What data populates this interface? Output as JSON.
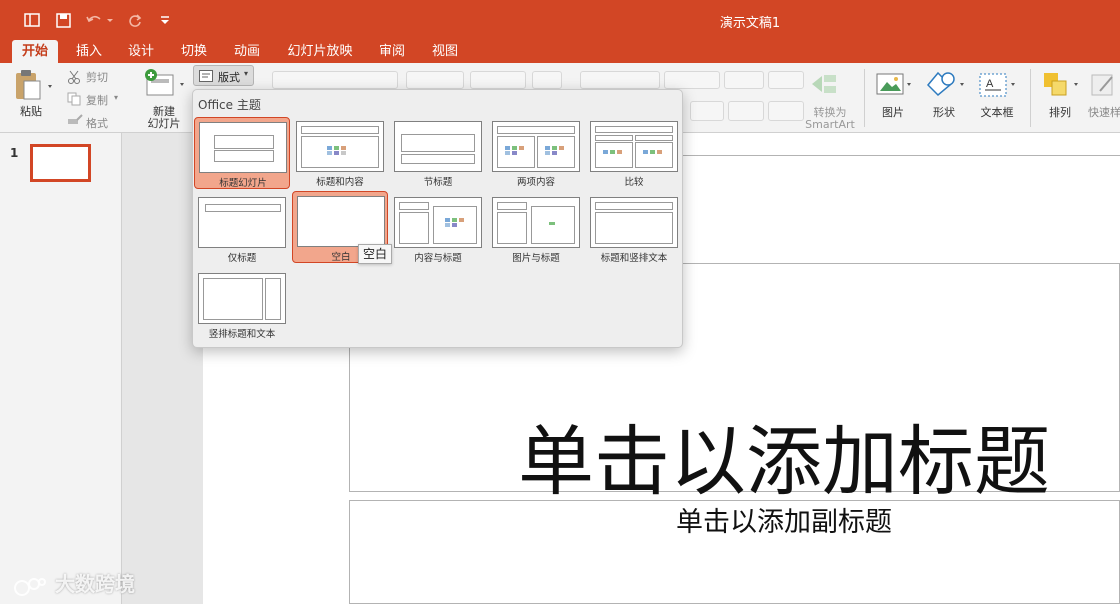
{
  "window": {
    "title": "演示文稿1"
  },
  "tabs": [
    "开始",
    "插入",
    "设计",
    "切换",
    "动画",
    "幻灯片放映",
    "审阅",
    "视图"
  ],
  "ribbon": {
    "paste": "粘贴",
    "cut": "剪切",
    "copy": "复制",
    "format": "格式",
    "new_slide_line1": "新建",
    "new_slide_line2": "幻灯片",
    "layout_button": "版式",
    "convert_line1": "转换为",
    "convert_line2": "SmartArt",
    "picture": "图片",
    "shape": "形状",
    "textbox": "文本框",
    "arrange": "排列",
    "quick_styles": "快速样"
  },
  "thumbnails": {
    "slide_number": "1"
  },
  "layout_menu": {
    "header": "Office 主题",
    "items": [
      "标题幻灯片",
      "标题和内容",
      "节标题",
      "两项内容",
      "比较",
      "仅标题",
      "空白",
      "内容与标题",
      "图片与标题",
      "标题和竖排文本",
      "竖排标题和文本"
    ],
    "selected": "标题幻灯片",
    "hovered": "空白",
    "tooltip": "空白"
  },
  "slide": {
    "title_placeholder": "单击以添加标题",
    "subtitle_placeholder": "单击以添加副标题"
  },
  "watermark": "大数跨境",
  "colors": {
    "accent": "#d24625",
    "selection": "#f2a68c"
  }
}
